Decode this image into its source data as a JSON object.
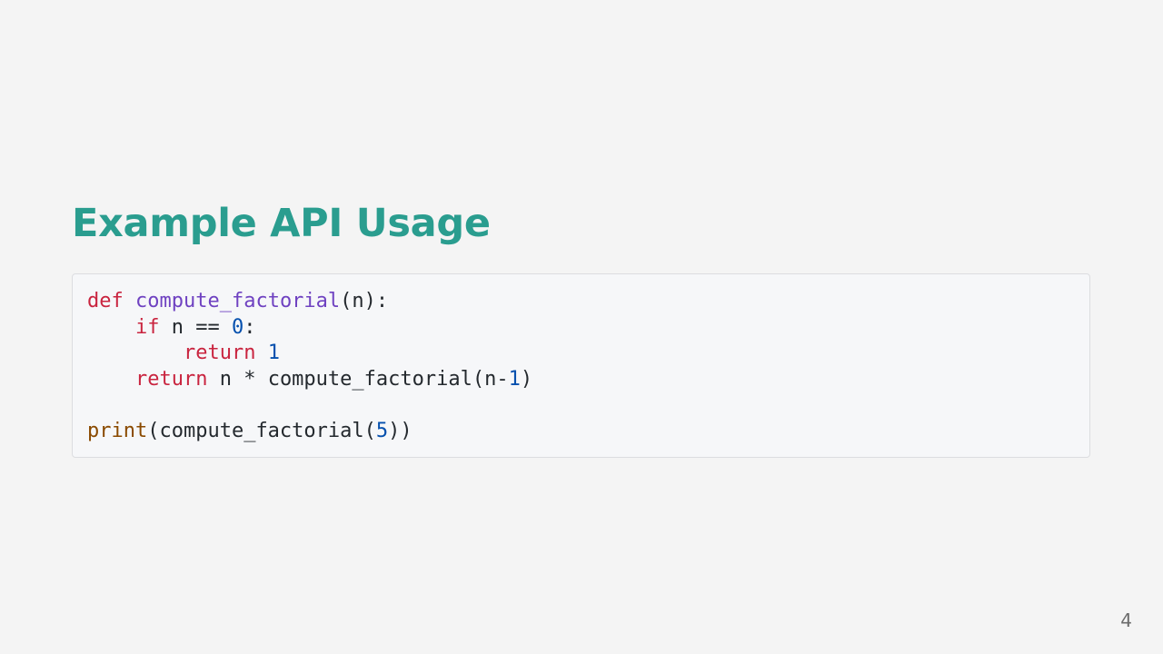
{
  "slide": {
    "title": "Example API Usage",
    "page_number": "4"
  },
  "code": {
    "language": "python",
    "colors": {
      "keyword": "#c9243f",
      "function": "#6f42c1",
      "number": "#0550ae",
      "builtin": "#8a4a00",
      "text": "#24292e"
    },
    "lines": [
      {
        "tokens": [
          {
            "type": "keyword",
            "text": "def"
          },
          {
            "type": "plain",
            "text": " "
          },
          {
            "type": "function",
            "text": "compute_factorial"
          },
          {
            "type": "plain",
            "text": "(n):"
          }
        ]
      },
      {
        "tokens": [
          {
            "type": "plain",
            "text": "    "
          },
          {
            "type": "keyword",
            "text": "if"
          },
          {
            "type": "plain",
            "text": " n == "
          },
          {
            "type": "number",
            "text": "0"
          },
          {
            "type": "plain",
            "text": ":"
          }
        ]
      },
      {
        "tokens": [
          {
            "type": "plain",
            "text": "        "
          },
          {
            "type": "keyword",
            "text": "return"
          },
          {
            "type": "plain",
            "text": " "
          },
          {
            "type": "number",
            "text": "1"
          }
        ]
      },
      {
        "tokens": [
          {
            "type": "plain",
            "text": "    "
          },
          {
            "type": "keyword",
            "text": "return"
          },
          {
            "type": "plain",
            "text": " n * compute_factorial(n-"
          },
          {
            "type": "number",
            "text": "1"
          },
          {
            "type": "plain",
            "text": ")"
          }
        ]
      },
      {
        "tokens": [
          {
            "type": "plain",
            "text": ""
          }
        ]
      },
      {
        "tokens": [
          {
            "type": "builtin",
            "text": "print"
          },
          {
            "type": "plain",
            "text": "(compute_factorial("
          },
          {
            "type": "number",
            "text": "5"
          },
          {
            "type": "plain",
            "text": "))"
          }
        ]
      }
    ]
  }
}
